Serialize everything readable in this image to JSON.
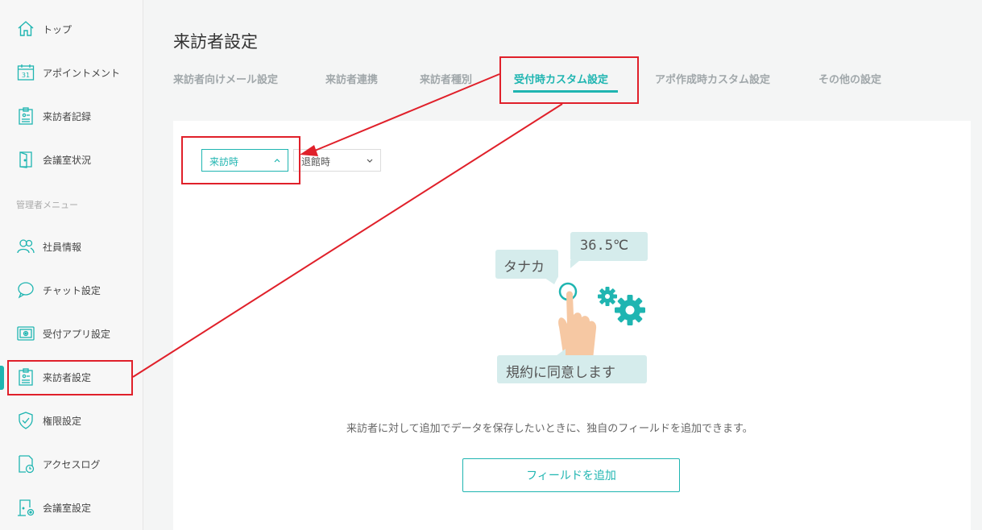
{
  "sidebar": {
    "items": [
      {
        "label": "トップ",
        "icon": "home-icon"
      },
      {
        "label": "アポイントメント",
        "icon": "calendar-icon"
      },
      {
        "label": "来訪者記録",
        "icon": "clipboard-icon"
      },
      {
        "label": "会議室状況",
        "icon": "door-icon"
      }
    ],
    "admin_section_label": "管理者メニュー",
    "admin_items": [
      {
        "label": "社員情報",
        "icon": "users-icon"
      },
      {
        "label": "チャット設定",
        "icon": "chat-icon"
      },
      {
        "label": "受付アプリ設定",
        "icon": "tablet-gear-icon"
      },
      {
        "label": "来訪者設定",
        "icon": "clipboard-icon",
        "active": true
      },
      {
        "label": "権限設定",
        "icon": "shield-check-icon"
      },
      {
        "label": "アクセスログ",
        "icon": "doc-clock-icon"
      },
      {
        "label": "会議室設定",
        "icon": "door-gear-icon"
      }
    ]
  },
  "main": {
    "title": "来訪者設定",
    "tabs": [
      {
        "label": "来訪者向けメール設定"
      },
      {
        "label": "来訪者連携"
      },
      {
        "label": "来訪者種別"
      },
      {
        "label": "受付時カスタム設定",
        "active": true
      },
      {
        "label": "アポ作成時カスタム設定"
      },
      {
        "label": "その他の設定"
      }
    ],
    "dropdowns": [
      {
        "label": "来訪時",
        "state": "selected"
      },
      {
        "label": "退館時",
        "state": "unselected"
      }
    ],
    "illustration": {
      "bubble_name": "タナカ",
      "bubble_temp": "36.5℃",
      "bubble_agree": "規約に同意します"
    },
    "description": "来訪者に対して追加でデータを保存したいときに、独自のフィールドを追加できます。",
    "add_button_label": "フィールドを追加"
  },
  "colors": {
    "accent": "#1fb5b1",
    "annotation": "#e0202a",
    "bubble": "#d5ecec"
  }
}
